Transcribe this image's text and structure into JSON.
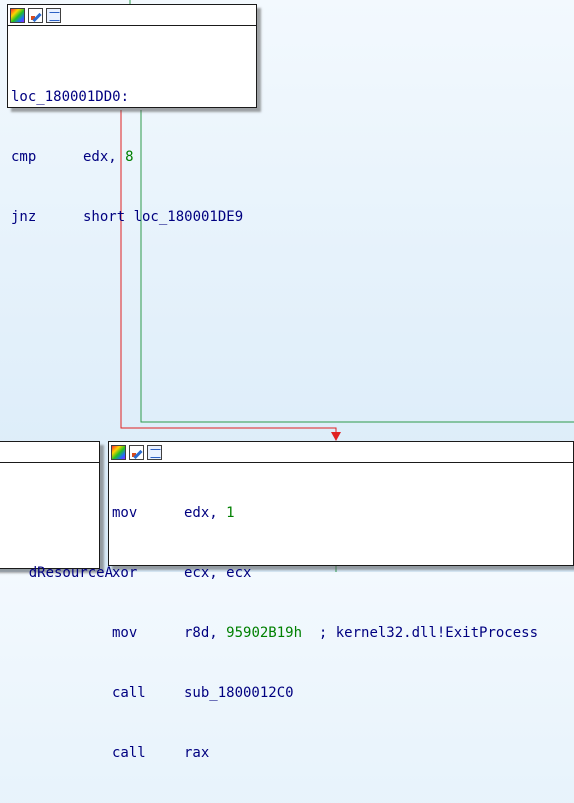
{
  "colors": {
    "edge_false": "#e02020",
    "edge_true": "#2e9a4a",
    "text": "#000080",
    "number": "#008000"
  },
  "block_top": {
    "icons": [
      "color-icon",
      "edit-icon",
      "graph-icon"
    ],
    "label": "loc_180001DD0:",
    "lines": [
      {
        "mnemonic": "cmp",
        "operand": "edx, ",
        "number": "8"
      },
      {
        "mnemonic": "jnz",
        "operand": "short loc_180001DE9"
      }
    ]
  },
  "block_left": {
    "partial_text": "dResourceA"
  },
  "block_bottom": {
    "icons": [
      "color-icon",
      "edit-icon",
      "graph-icon"
    ],
    "lines": [
      {
        "mnemonic": "mov",
        "operand": "edx, ",
        "number": "1"
      },
      {
        "mnemonic": "xor",
        "operand": "ecx, ecx"
      },
      {
        "mnemonic": "mov",
        "operand": "r8d, ",
        "number": "95902B19h",
        "comment": "  ; kernel32.dll!ExitProcess"
      },
      {
        "mnemonic": "call",
        "operand": "sub_1800012C0"
      },
      {
        "mnemonic": "call",
        "operand": "rax"
      }
    ]
  }
}
